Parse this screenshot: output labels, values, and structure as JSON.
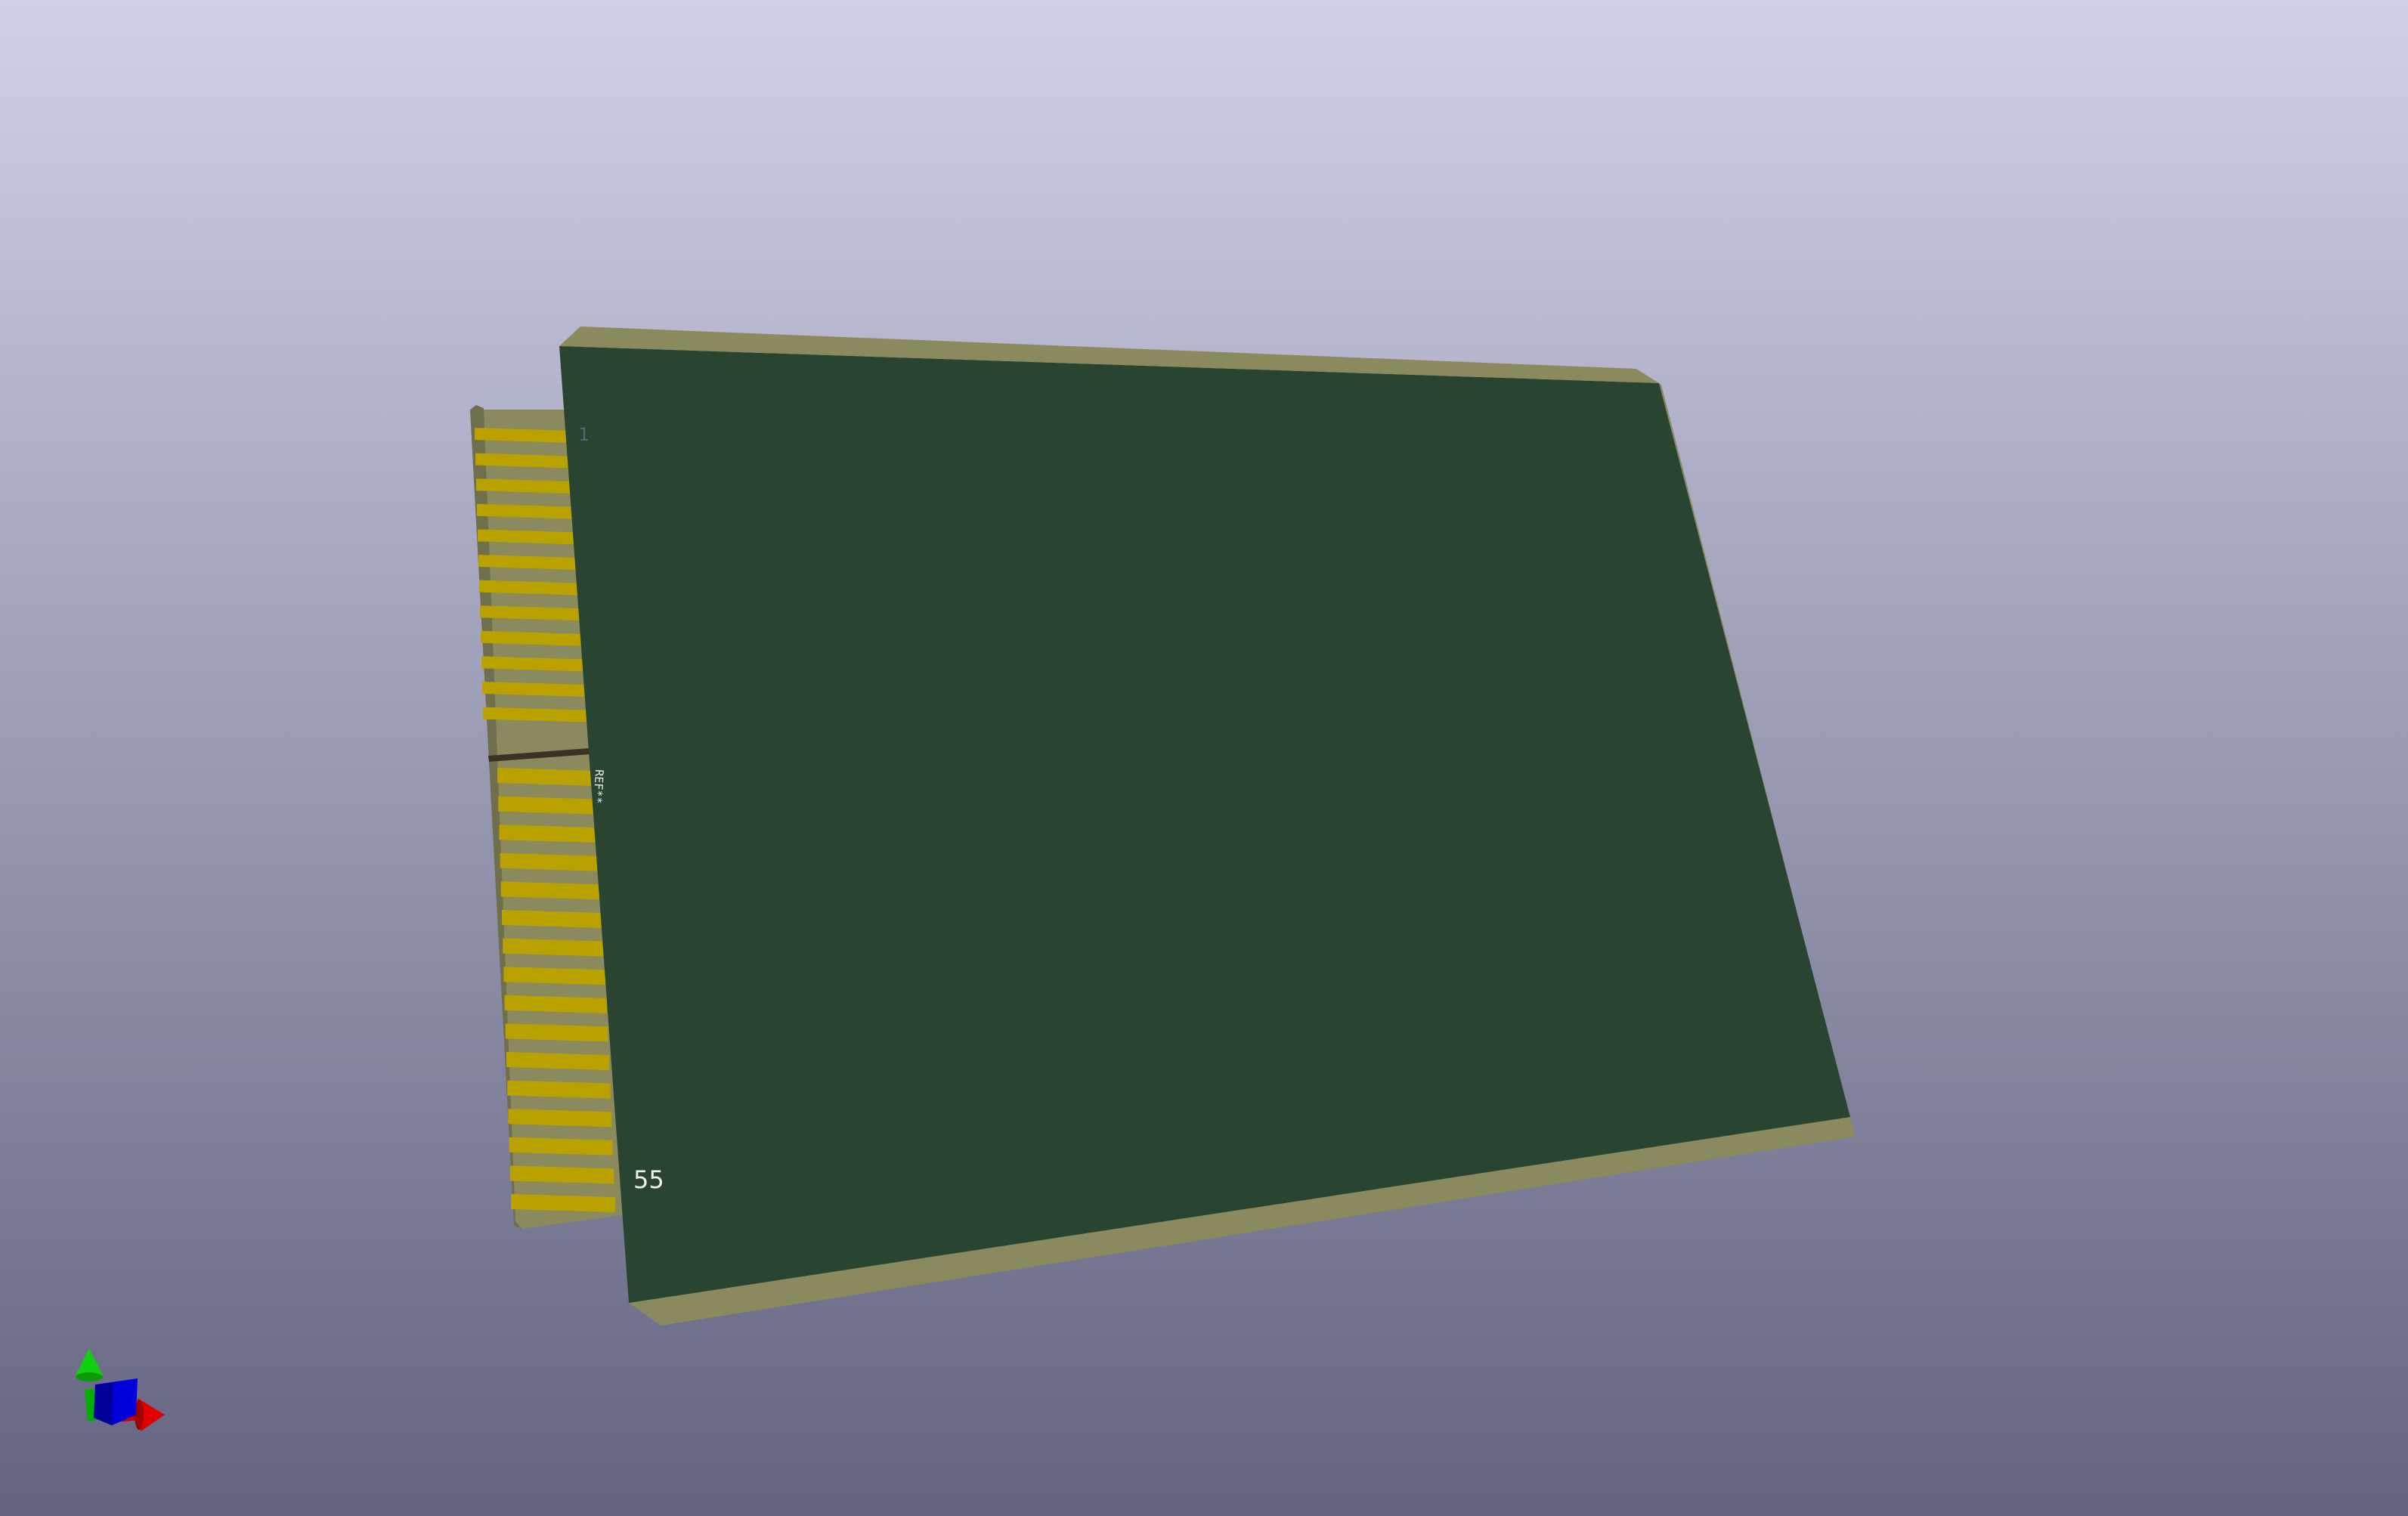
{
  "viewer": {
    "background_top": "#cfd0e6",
    "background_bottom": "#636480"
  },
  "board": {
    "mask_color": "#294430",
    "substrate_color": "#8a8a5e",
    "finger_color": "#b9a100",
    "pin_first_label": "1",
    "pin_last_label": "55",
    "reference_label": "REF**"
  },
  "axes": {
    "x_color": "#e00000",
    "y_color": "#00c000",
    "z_color": "#0000e0"
  }
}
